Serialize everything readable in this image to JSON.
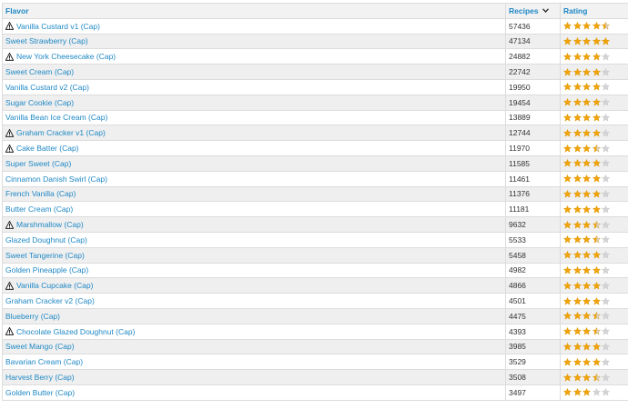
{
  "table": {
    "headers": {
      "flavor": "Flavor",
      "recipes": "Recipes",
      "rating": "Rating"
    },
    "sort_icon": "chevron-down-icon",
    "colors": {
      "link": "#1f88c5",
      "star_filled": "#f0a30a",
      "star_empty": "#d3d3d3"
    },
    "rows": [
      {
        "flavor": "Vanilla Custard v1 (Cap)",
        "warning": true,
        "recipes": "57436",
        "rating": 4.5
      },
      {
        "flavor": "Sweet Strawberry (Cap)",
        "warning": false,
        "recipes": "47134",
        "rating": 5
      },
      {
        "flavor": "New York Cheesecake (Cap)",
        "warning": true,
        "recipes": "24882",
        "rating": 4
      },
      {
        "flavor": "Sweet Cream (Cap)",
        "warning": false,
        "recipes": "22742",
        "rating": 4
      },
      {
        "flavor": "Vanilla Custard v2 (Cap)",
        "warning": false,
        "recipes": "19950",
        "rating": 4
      },
      {
        "flavor": "Sugar Cookie (Cap)",
        "warning": false,
        "recipes": "19454",
        "rating": 4
      },
      {
        "flavor": "Vanilla Bean Ice Cream (Cap)",
        "warning": false,
        "recipes": "13889",
        "rating": 4
      },
      {
        "flavor": "Graham Cracker v1 (Cap)",
        "warning": true,
        "recipes": "12744",
        "rating": 4
      },
      {
        "flavor": "Cake Batter (Cap)",
        "warning": true,
        "recipes": "11970",
        "rating": 3.5
      },
      {
        "flavor": "Super Sweet (Cap)",
        "warning": false,
        "recipes": "11585",
        "rating": 4
      },
      {
        "flavor": "Cinnamon Danish Swirl (Cap)",
        "warning": false,
        "recipes": "11461",
        "rating": 4
      },
      {
        "flavor": "French Vanilla (Cap)",
        "warning": false,
        "recipes": "11376",
        "rating": 4
      },
      {
        "flavor": "Butter Cream (Cap)",
        "warning": false,
        "recipes": "11181",
        "rating": 4
      },
      {
        "flavor": "Marshmallow (Cap)",
        "warning": true,
        "recipes": "9632",
        "rating": 3.5
      },
      {
        "flavor": "Glazed Doughnut (Cap)",
        "warning": false,
        "recipes": "5533",
        "rating": 3.5
      },
      {
        "flavor": "Sweet Tangerine (Cap)",
        "warning": false,
        "recipes": "5458",
        "rating": 4
      },
      {
        "flavor": "Golden Pineapple (Cap)",
        "warning": false,
        "recipes": "4982",
        "rating": 4
      },
      {
        "flavor": "Vanilla Cupcake (Cap)",
        "warning": true,
        "recipes": "4866",
        "rating": 4
      },
      {
        "flavor": "Graham Cracker v2 (Cap)",
        "warning": false,
        "recipes": "4501",
        "rating": 4
      },
      {
        "flavor": "Blueberry (Cap)",
        "warning": false,
        "recipes": "4475",
        "rating": 3.5
      },
      {
        "flavor": "Chocolate Glazed Doughnut (Cap)",
        "warning": true,
        "recipes": "4393",
        "rating": 3.5
      },
      {
        "flavor": "Sweet Mango (Cap)",
        "warning": false,
        "recipes": "3985",
        "rating": 4
      },
      {
        "flavor": "Bavarian Cream (Cap)",
        "warning": false,
        "recipes": "3529",
        "rating": 4
      },
      {
        "flavor": "Harvest Berry (Cap)",
        "warning": false,
        "recipes": "3508",
        "rating": 3.5
      },
      {
        "flavor": "Golden Butter (Cap)",
        "warning": false,
        "recipes": "3497",
        "rating": 3
      }
    ]
  }
}
